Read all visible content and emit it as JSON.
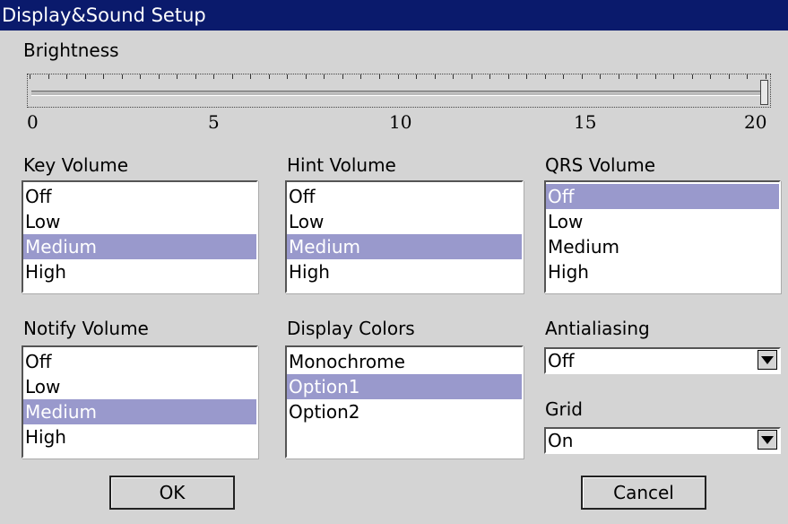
{
  "window": {
    "title": "Display&Sound  Setup"
  },
  "brightness": {
    "label": "Brightness",
    "value": 20,
    "min": 0,
    "max": 20,
    "scale_labels": [
      "0",
      "5",
      "10",
      "15",
      "20"
    ]
  },
  "key_volume": {
    "label": "Key  Volume",
    "options": [
      "Off",
      "Low",
      "Medium",
      "High"
    ],
    "selected": "Medium"
  },
  "hint_volume": {
    "label": "Hint  Volume",
    "options": [
      "Off",
      "Low",
      "Medium",
      "High"
    ],
    "selected": "Medium"
  },
  "qrs_volume": {
    "label": "QRS  Volume",
    "options": [
      "Off",
      "Low",
      "Medium",
      "High"
    ],
    "selected": "Off"
  },
  "notify_volume": {
    "label": "Notify  Volume",
    "options": [
      "Off",
      "Low",
      "Medium",
      "High"
    ],
    "selected": "Medium"
  },
  "display_colors": {
    "label": "Display  Colors",
    "options": [
      "Monochrome",
      "Option1",
      "Option2"
    ],
    "selected": "Option1"
  },
  "antialiasing": {
    "label": "Antialiasing",
    "value": "Off"
  },
  "grid": {
    "label": "Grid",
    "value": "On"
  },
  "buttons": {
    "ok": "OK",
    "cancel": "Cancel"
  },
  "colors": {
    "title_bar": "#0a1a6c",
    "selection": "#9999cc",
    "background": "#d4d4d4"
  }
}
